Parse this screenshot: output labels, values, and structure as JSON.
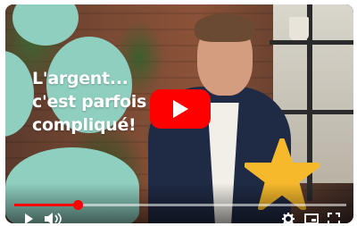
{
  "video": {
    "title_text": "L'argent...\nc'est parfois\ncompliqué!",
    "progress_fraction": 0.19
  },
  "player": {
    "play_button_icon": "play-icon",
    "brand_color": "#ff0000",
    "accent_blob_color": "#8fcfc0",
    "star_color": "#f6b92c"
  },
  "controls": {
    "play_icon": "play-icon",
    "volume_icon": "volume-icon",
    "settings_icon": "gear-icon",
    "miniplayer_icon": "miniplayer-icon",
    "fullscreen_icon": "fullscreen-icon"
  }
}
